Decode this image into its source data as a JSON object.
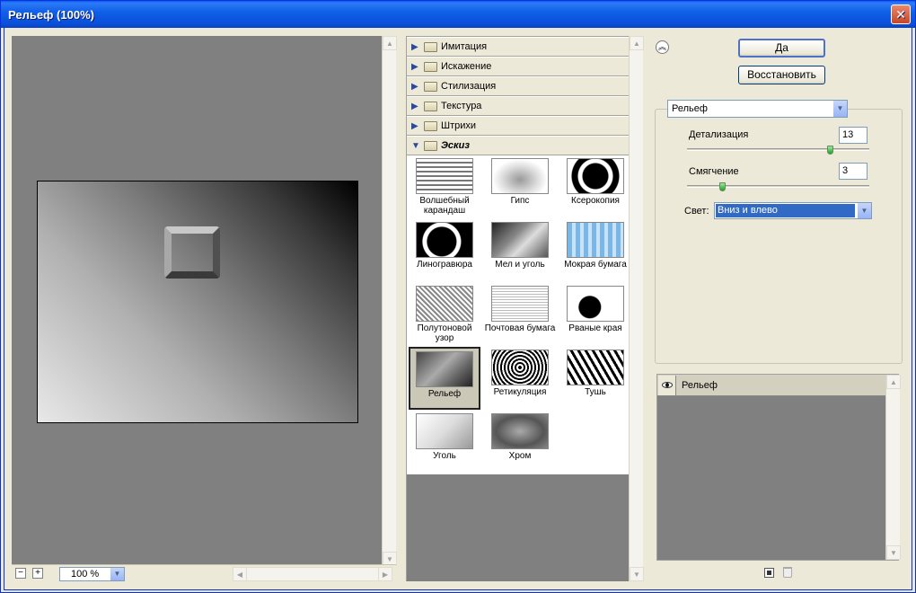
{
  "window": {
    "title": "Рельеф (100%)"
  },
  "preview": {
    "zoom_value": "100 %",
    "zoom_out_label": "−",
    "zoom_in_label": "+"
  },
  "categories": [
    {
      "label": "Имитация",
      "open": false
    },
    {
      "label": "Искажение",
      "open": false
    },
    {
      "label": "Стилизация",
      "open": false
    },
    {
      "label": "Текстура",
      "open": false
    },
    {
      "label": "Штрихи",
      "open": false
    },
    {
      "label": "Эскиз",
      "open": true
    }
  ],
  "filters": [
    {
      "label": "Волшебный карандаш"
    },
    {
      "label": "Гипс"
    },
    {
      "label": "Ксерокопия"
    },
    {
      "label": "Линогравюра"
    },
    {
      "label": "Мел и уголь"
    },
    {
      "label": "Мокрая бумага"
    },
    {
      "label": "Полутоновой узор"
    },
    {
      "label": "Почтовая бумага"
    },
    {
      "label": "Рваные края"
    },
    {
      "label": "Рельеф",
      "selected": true
    },
    {
      "label": "Ретикуляция"
    },
    {
      "label": "Тушь"
    },
    {
      "label": "Уголь"
    },
    {
      "label": "Хром"
    }
  ],
  "buttons": {
    "ok_label": "Да",
    "reset_label": "Восстановить"
  },
  "settings": {
    "filter_select_value": "Рельеф",
    "detail": {
      "label": "Детализация",
      "value": "13",
      "level": 13,
      "max": 15
    },
    "smoothness": {
      "label": "Смягчение",
      "value": "3",
      "level": 3,
      "max": 15
    },
    "light": {
      "label": "Свет:",
      "value": "Вниз и влево"
    }
  },
  "layers": [
    {
      "label": "Рельеф",
      "visible": true
    }
  ]
}
